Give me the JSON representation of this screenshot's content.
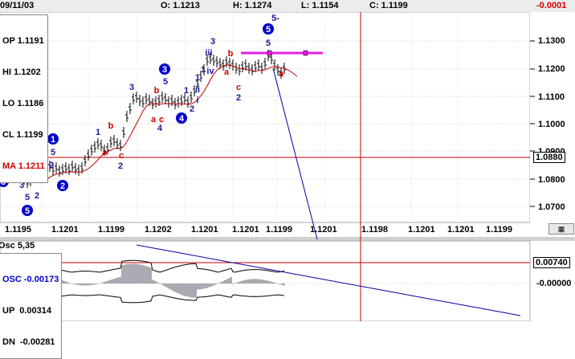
{
  "header": {
    "date": "09/11/03",
    "open": "O: 1.1213",
    "high": "H: 1.1274",
    "low": "L: 1.1154",
    "close": "C: 1.1199",
    "change": "-0.0001"
  },
  "price_panel": {
    "info": [
      {
        "text": "OP 1.1191",
        "color": "#000000"
      },
      {
        "text": "HI 1.1202",
        "color": "#000000"
      },
      {
        "text": "LO 1.1186",
        "color": "#000000"
      },
      {
        "text": "CL 1.1199",
        "color": "#000000"
      },
      {
        "text": "MA 1.1211",
        "color": "#d00000"
      }
    ],
    "y_ticks": [
      "1.1300",
      "1.1200",
      "1.1100",
      "1.1000",
      "1.0900",
      "1.0800",
      "1.0700"
    ],
    "current_level": "1.0880",
    "x_ticks": [
      "1.1195",
      "1.1201",
      "1.1199",
      "1.1202",
      "1.1201",
      "1.1201",
      "1.1199",
      "1.1201",
      "1.1198",
      "1.1201",
      "1.1201",
      "1.1199"
    ]
  },
  "osc_panel": {
    "title": "Osc 5,35",
    "info": [
      {
        "text": "OSC -0.00173",
        "color": "#0000cc"
      },
      {
        "text": "UP  0.00314",
        "color": "#000000"
      },
      {
        "text": "DN  -0.00281",
        "color": "#000000"
      }
    ],
    "level_high": "0.00740",
    "level_zero": "-0.00000"
  },
  "wave_labels": {
    "circled": [
      "4",
      "3",
      "1",
      "5",
      "2",
      "3",
      "4",
      "5"
    ],
    "blue": [
      "4",
      "3",
      "5",
      "2",
      "5",
      "3",
      "2",
      "1",
      "2",
      "3",
      "5",
      "1",
      "2",
      "1",
      "3",
      "iii",
      "iv",
      "1",
      "i",
      "ii",
      "4",
      "5",
      "5-"
    ],
    "red": [
      "a",
      "b",
      "c",
      "a",
      "b",
      "c",
      "b",
      "a",
      "c",
      "a"
    ]
  },
  "colors": {
    "grid": "#c8c8c8",
    "candles": "#000000",
    "moving_average": "#c00000",
    "trendline": "#0000a0",
    "vertical_marker": "#c00000",
    "target_line": "#e020e0",
    "wave_circle": "#0000cc"
  }
}
